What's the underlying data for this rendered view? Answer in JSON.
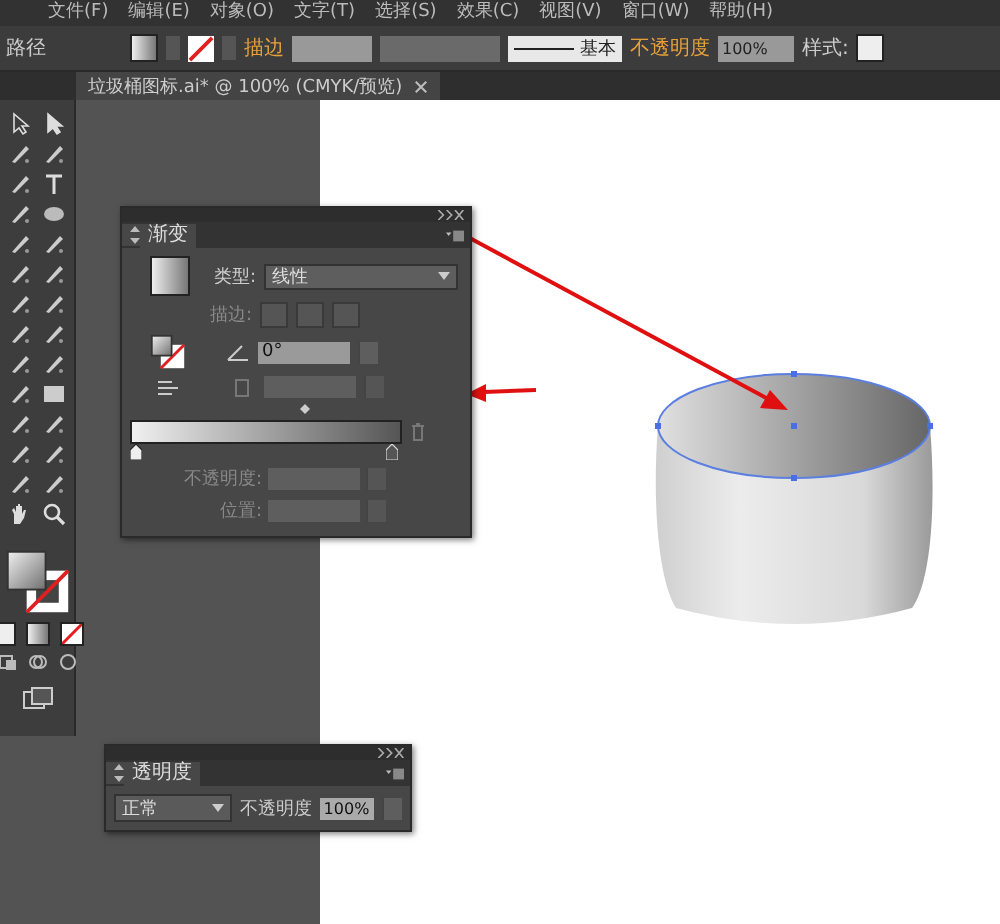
{
  "menu_bar": [
    "文件(F)",
    "编辑(E)",
    "对象(O)",
    "文字(T)",
    "选择(S)",
    "效果(C)",
    "视图(V)",
    "窗口(W)",
    "帮助(H)"
  ],
  "control_bar": {
    "selection_label": "路径",
    "stroke_label": "描边",
    "stroke_profile": "基本",
    "opacity_label": "不透明度",
    "opacity_value": "100%",
    "style_label": "样式:"
  },
  "document_tab": {
    "title": "垃圾桶图标.ai* @ 100% (CMYK/预览)"
  },
  "gradient_panel": {
    "title": "渐变",
    "type_label": "类型:",
    "type_value": "线性",
    "stroke_label": "描边:",
    "angle_value": "0°",
    "opacity_label": "不透明度:",
    "location_label": "位置:"
  },
  "transparency_panel": {
    "title": "透明度",
    "blend_mode": "正常",
    "opacity_label": "不透明度",
    "opacity_value": "100%"
  }
}
